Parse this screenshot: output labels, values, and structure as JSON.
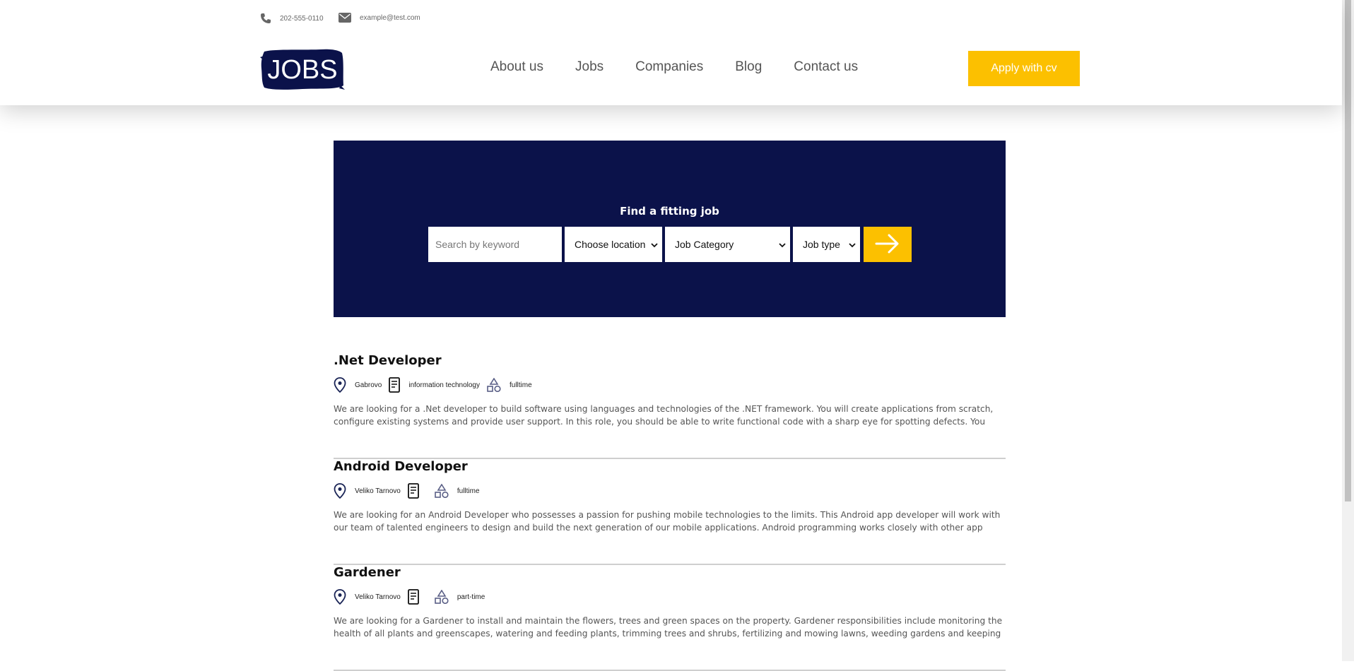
{
  "header": {
    "phone": "202-555-0110",
    "email": "example@test.com",
    "logo_text": "JOBS",
    "nav": [
      {
        "label": "About us"
      },
      {
        "label": "Jobs"
      },
      {
        "label": "Companies"
      },
      {
        "label": "Blog"
      },
      {
        "label": "Contact us"
      }
    ],
    "apply_label": "Apply with cv"
  },
  "search": {
    "title": "Find a fitting job",
    "keyword_placeholder": "Search by keyword",
    "location_value": "Choose location",
    "category_value": "Job Category",
    "type_value": "Job type"
  },
  "jobs": [
    {
      "title": ".Net Developer",
      "location": "Gabrovo",
      "category": "information technology",
      "type": "fulltime",
      "description": "We are looking for a .Net developer to build software using languages and technologies of the .NET framework. You will create applications from scratch, configure existing systems and provide user support. In this role, you should be able to write functional code with a sharp eye for spotting defects. You should be a team playe..."
    },
    {
      "title": "Android Developer",
      "location": "Veliko Tarnovo",
      "category": "",
      "type": "fulltime",
      "description": "We are looking for an Android Developer who possesses a passion for pushing mobile technologies to the limits. This Android app developer will work with our team of talented engineers to design and build the next generation of our mobile applications. Android programming works closely with other app development and..."
    },
    {
      "title": "Gardener",
      "location": "Veliko Tarnovo",
      "category": "",
      "type": "part-time",
      "description": "We are looking for a Gardener to install and maintain the flowers, trees and green spaces on the property. Gardener responsibilities include monitoring the health of all plants and greenscapes, watering and feeding plants, trimming trees and shrubs, fertilizing and mowing lawns, weeding gardens and keeping green spaces and..."
    }
  ],
  "colors": {
    "navy": "#0b124a",
    "accent": "#fcc000"
  },
  "icons": [
    "phone-icon",
    "mail-icon",
    "arrow-right-icon",
    "location-pin-icon",
    "document-icon",
    "shapes-icon",
    "chevron-down-icon"
  ]
}
